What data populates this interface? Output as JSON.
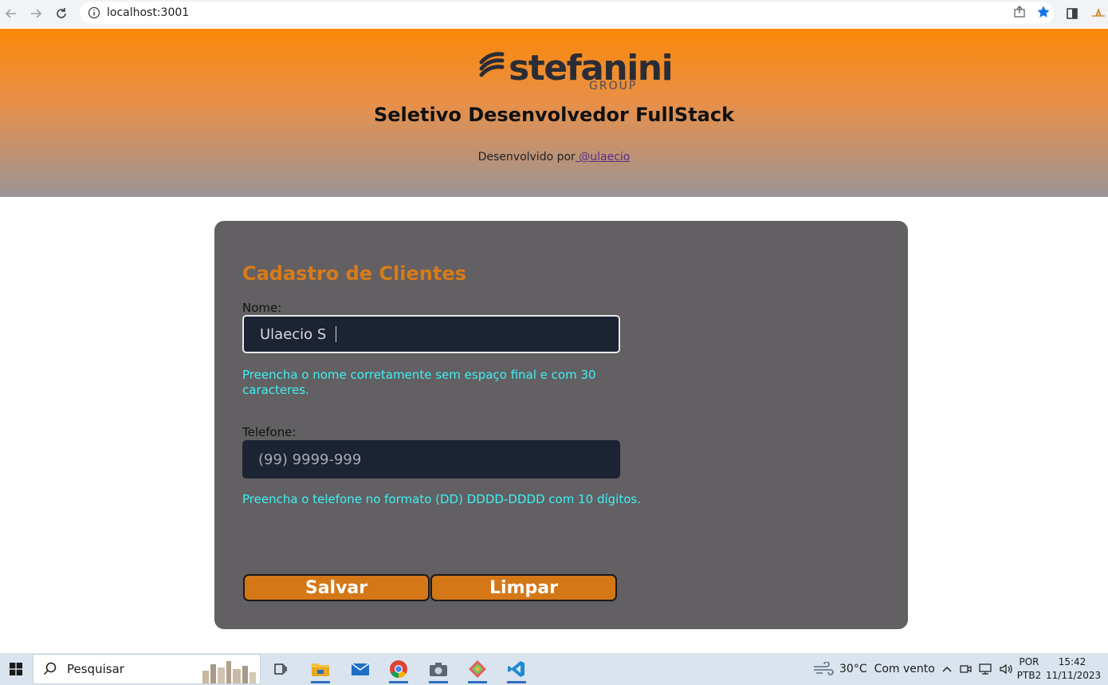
{
  "browser": {
    "url": "localhost:3001",
    "back_icon": "arrow-left-icon",
    "forward_icon": "arrow-right-icon",
    "reload_icon": "reload-icon"
  },
  "header": {
    "logo_text": "stefanini",
    "logo_sub": "GROUP",
    "title": "Seletivo Desenvolvedor FullStack",
    "subtitle_prefix": "Desenvolvido por",
    "subtitle_link": " @ulaecio"
  },
  "form": {
    "title": "Cadastro de Clientes",
    "name": {
      "label": "Nome:",
      "value": "Ulaecio S ",
      "hint": "Preencha o nome corretamente sem espaço final e com 30 caracteres."
    },
    "phone": {
      "label": "Telefone:",
      "placeholder": "(99) 9999-999",
      "hint": "Preencha o telefone no formato (DD) DDDD-DDDD com 10 dígitos."
    },
    "save_label": "Salvar",
    "clear_label": "Limpar"
  },
  "taskbar": {
    "search_placeholder": "Pesquisar",
    "weather": "30°C",
    "weather_desc": "Com vento",
    "lang_top": "POR",
    "lang_bottom": "PTB2",
    "time": "15:42",
    "date": "11/11/2023"
  },
  "colors": {
    "accent": "#d47717",
    "hint": "#3ff0f2",
    "card": "#626063",
    "input_bg": "#1c2333"
  }
}
